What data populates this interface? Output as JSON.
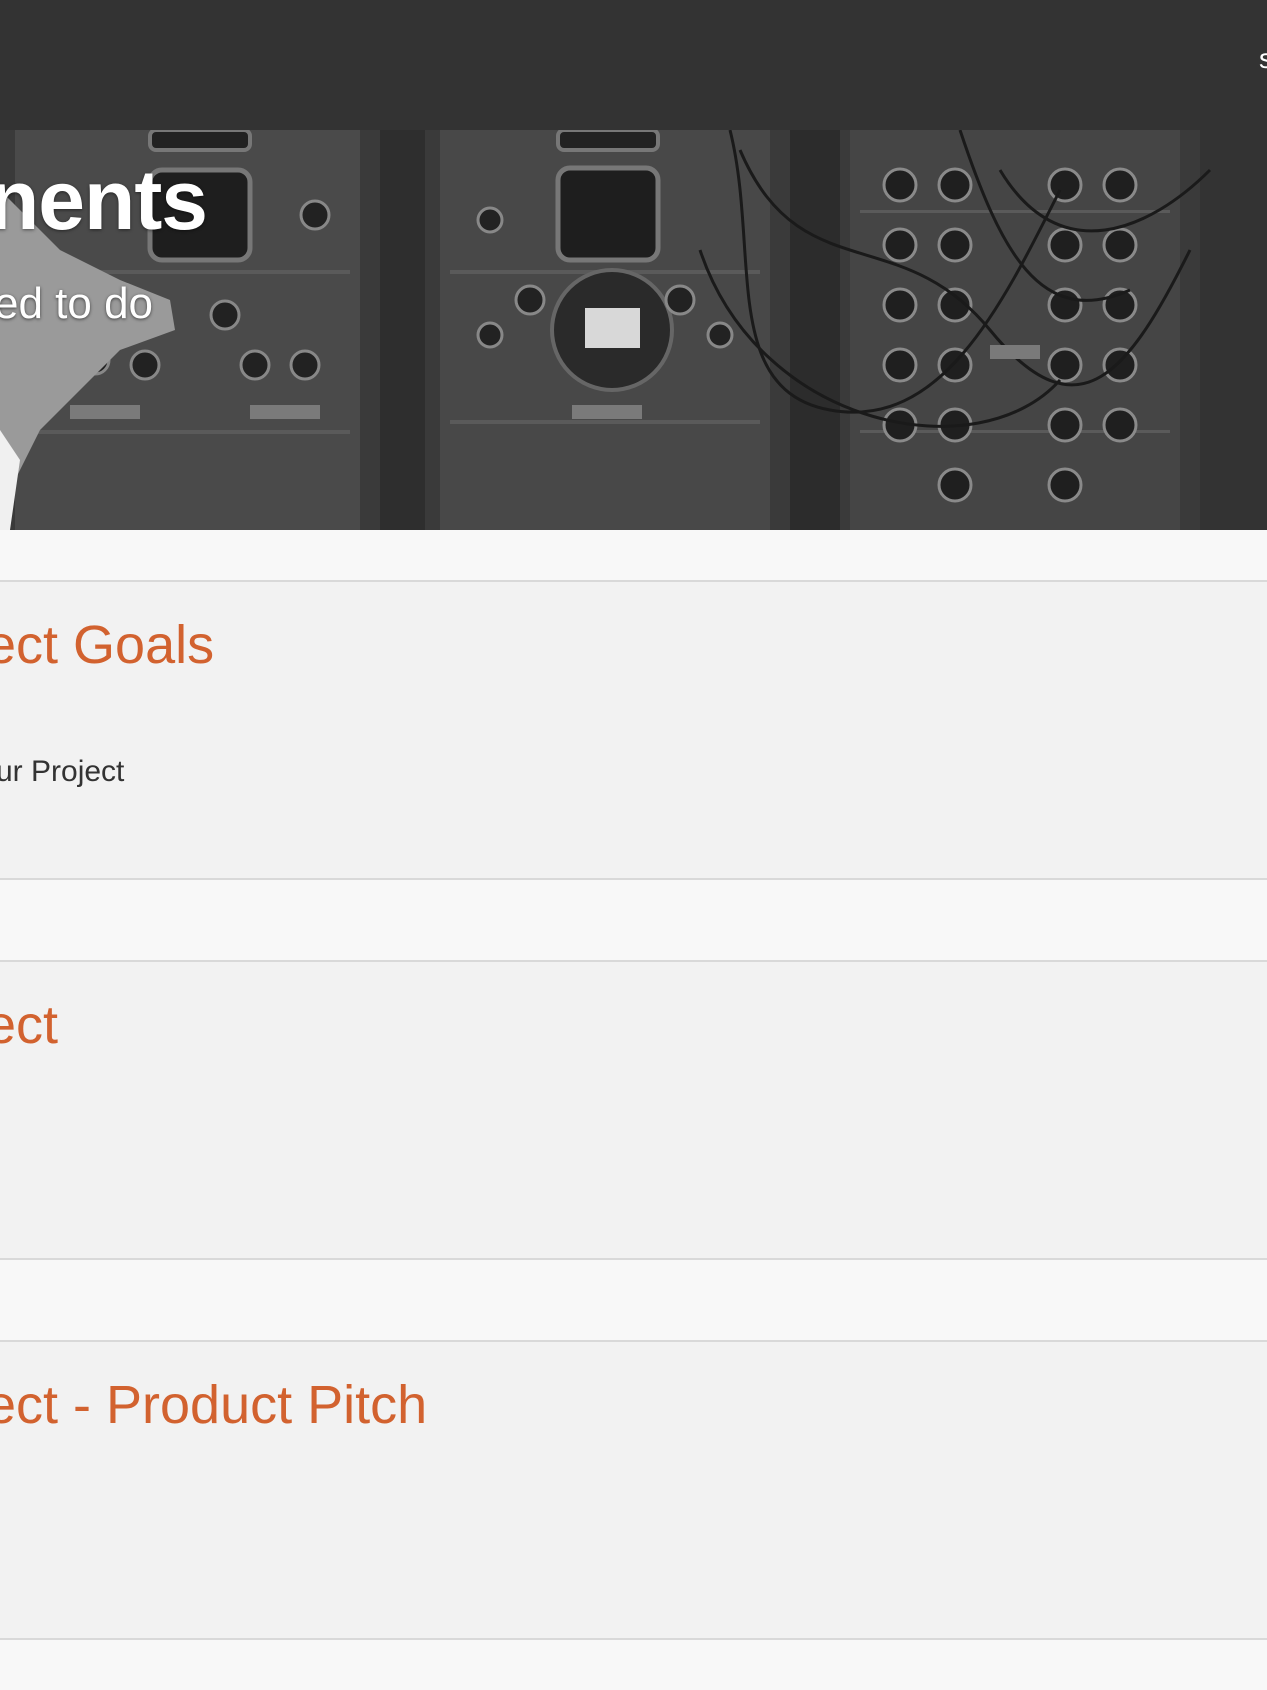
{
  "header": {
    "edge_glyph": "s"
  },
  "hero": {
    "title": "nents",
    "subtitle": "ed to do"
  },
  "sections": [
    {
      "title": "ect Goals",
      "text": "ur Project"
    },
    {
      "title": "ect",
      "text": ""
    },
    {
      "title": "ect - Product Pitch",
      "text": ""
    }
  ]
}
